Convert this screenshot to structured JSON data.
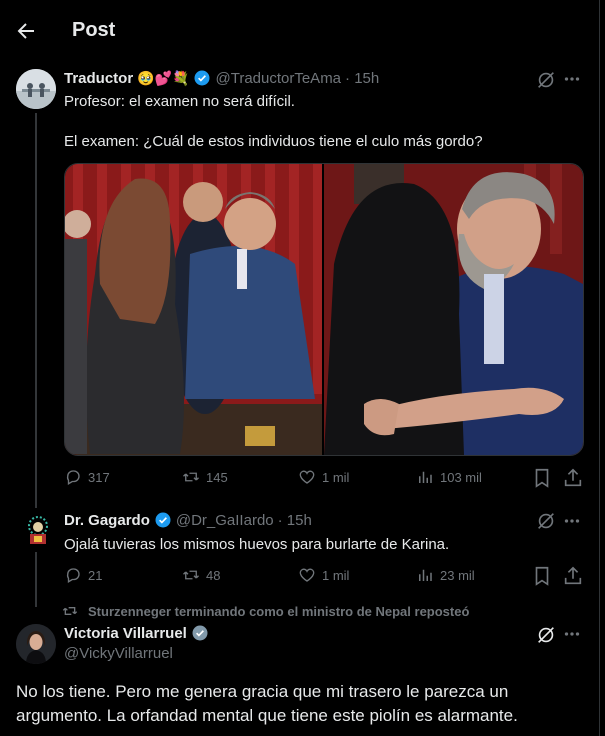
{
  "header": {
    "title": "Post"
  },
  "tweet1": {
    "name": "Traductor",
    "emojis": "🥹💕💐",
    "handle": "@TraductorTeAma",
    "time": "· 15h",
    "line1": "Profesor: el examen no será difícil.",
    "line2": "El examen: ¿Cuál de estos individuos tiene el culo más gordo?",
    "stats": {
      "replies": "317",
      "reposts": "145",
      "likes": "1 mil",
      "views": "103 mil"
    }
  },
  "tweet2": {
    "name": "Dr. Gagardo",
    "handle": "@Dr_GaIIardo",
    "time": "· 15h",
    "text": "Ojalá tuvieras los mismos huevos para burlarte de Karina.",
    "stats": {
      "replies": "21",
      "reposts": "48",
      "likes": "1 mil",
      "views": "23 mil"
    }
  },
  "tweet3": {
    "repost_note": "Sturzenneger terminando como el ministro de Nepal reposteó",
    "name": "Victoria Villarruel",
    "handle": "@VickyVillarruel",
    "text_line1": "No los tiene. Pero me genera gracia que mi trasero le parezca un",
    "text_line2": "argumento. La orfandad mental que tiene este piolín es alarmante."
  },
  "colors": {
    "background": "#000000",
    "text": "#e7e9ea",
    "muted": "#71767b",
    "verified": "#1d9bf0",
    "gray_badge": "#829aab"
  }
}
